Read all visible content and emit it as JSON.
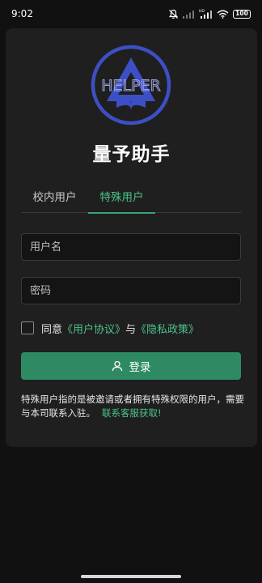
{
  "status_bar": {
    "time": "9:02",
    "icons": [
      "mute-bell-icon",
      "signal-icon",
      "signal-hd-icon",
      "wifi-icon",
      "battery-icon"
    ],
    "battery": "100"
  },
  "app": {
    "logo_text": "HELPER",
    "title": "量予助手"
  },
  "tabs": [
    {
      "label": "校内用户",
      "active": false
    },
    {
      "label": "特殊用户",
      "active": true
    }
  ],
  "form": {
    "username_placeholder": "用户名",
    "password_placeholder": "密码"
  },
  "agreement": {
    "prefix": "同意",
    "user_agreement": "《用户协议》",
    "joiner": "与",
    "privacy_policy": "《隐私政策》"
  },
  "login_button": {
    "label": "登录",
    "icon": "user-icon"
  },
  "note": {
    "text": "特殊用户指的是被邀请或者拥有特殊权限的用户，需要与本司联系入驻。",
    "link": "联系客服获取!"
  },
  "colors": {
    "accent": "#4cc38a",
    "button": "#2e8a63",
    "logo_blue": "#3d4fc4",
    "card_bg": "#1f1f1f",
    "page_bg": "#111111"
  }
}
